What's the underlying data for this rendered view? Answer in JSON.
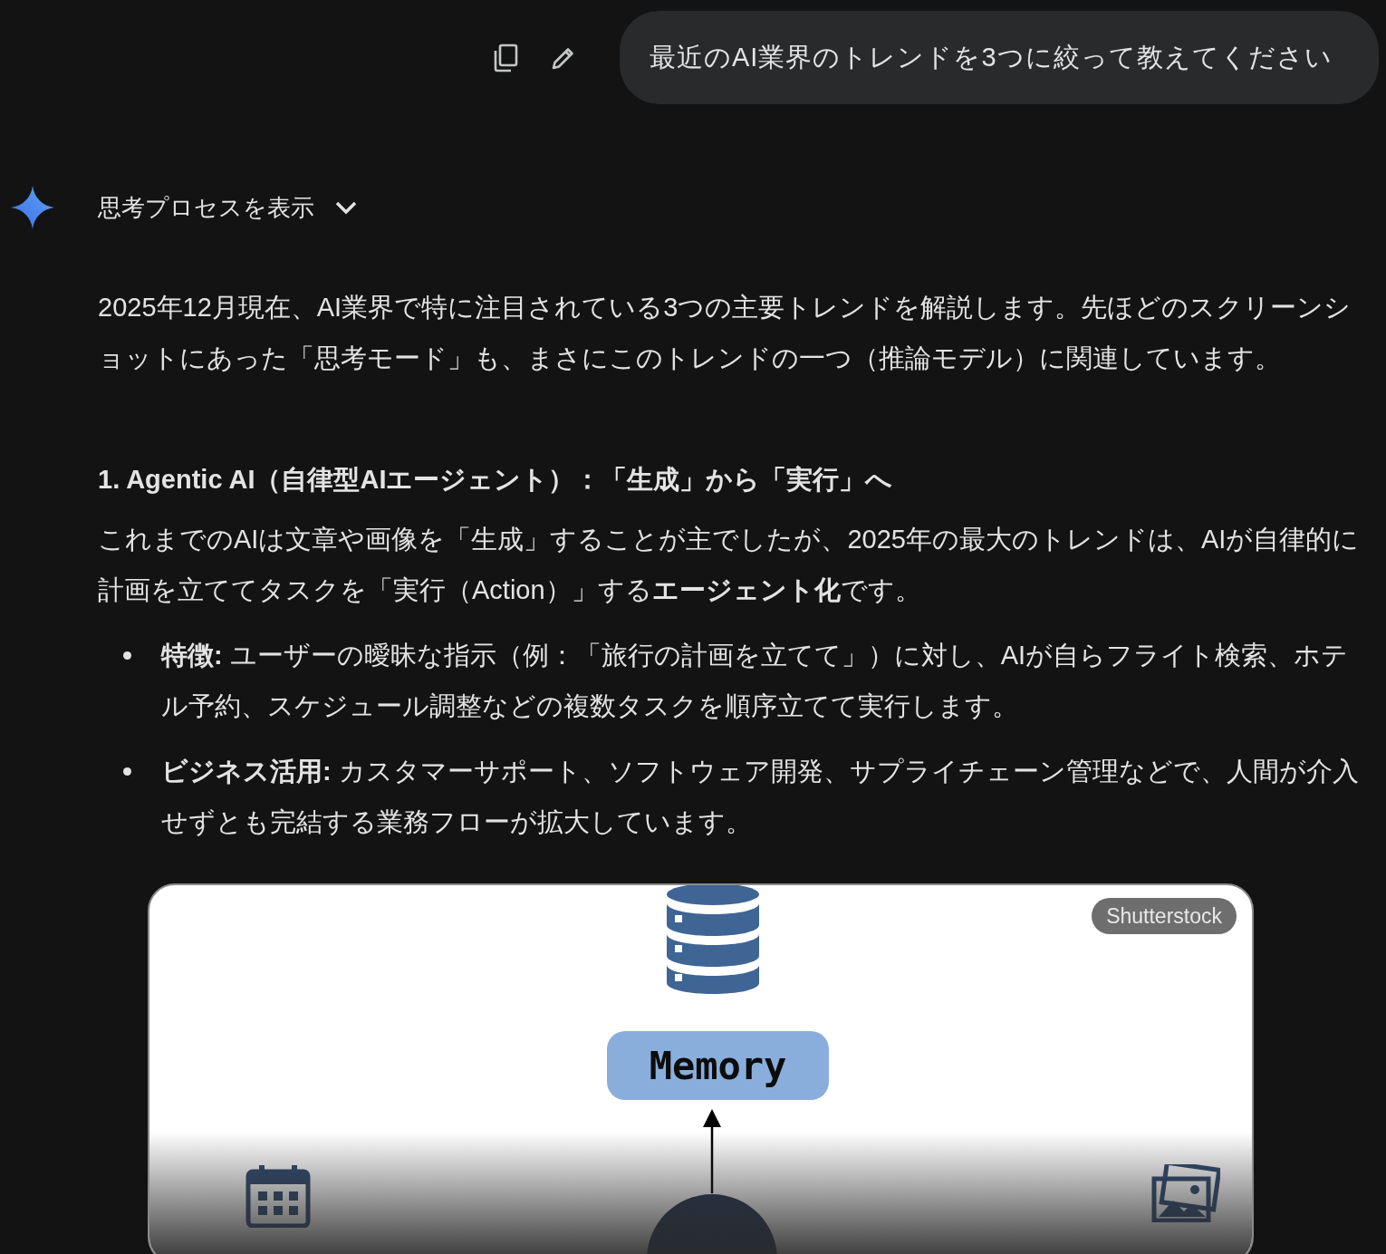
{
  "user_message": {
    "text": "最近のAI業界のトレンドを3つに絞って教えてください"
  },
  "response": {
    "thinking_toggle": {
      "label": "思考プロセスを表示",
      "expanded": false
    },
    "intro": "2025年12月現在、AI業界で特に注目されている3つの主要トレンドを解説します。先ほどのスクリーンショットにあった「思考モード」も、まさにこのトレンドの一つ（推論モデル）に関連しています。",
    "sections": [
      {
        "heading": "1. Agentic AI（自律型AIエージェント）：「生成」から「実行」へ",
        "body": "これまでのAIは文章や画像を「生成」することが主でしたが、2025年の最大のトレンドは、AIが自律的に計画を立ててタスクを「実行（Action）」する**エージェント化**です。",
        "bullets": [
          "**特徴:** ユーザーの曖昧な指示（例：「旅行の計画を立てて」）に対し、AIが自らフライト検索、ホテル予約、スケジュール調整などの複数タスクを順序立てて実行します。",
          "**ビジネス活用:** カスタマーサポート、ソフトウェア開発、サプライチェーン管理などで、人間が介入せずとも完結する業務フローが拡大しています。"
        ]
      }
    ],
    "image": {
      "source": "Shutterstock",
      "node_label": "Memory"
    }
  }
}
